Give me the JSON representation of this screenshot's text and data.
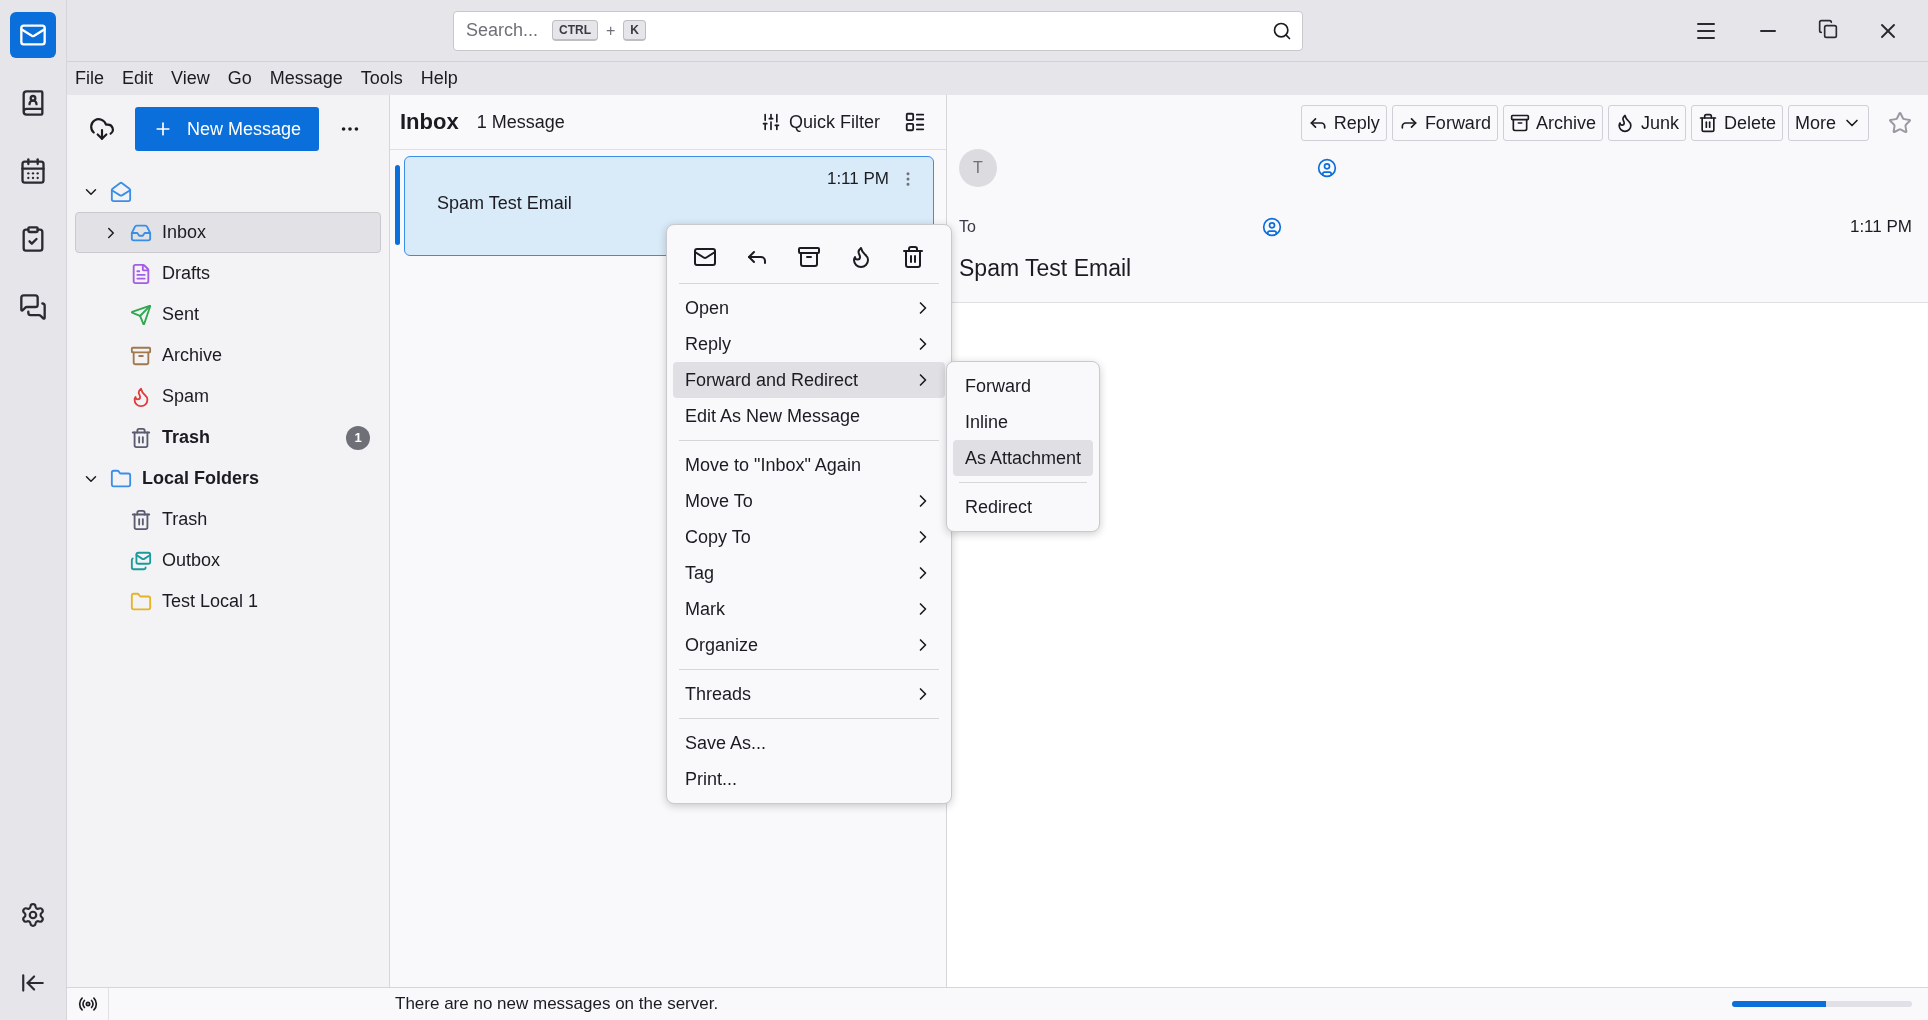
{
  "search": {
    "placeholder": "Search...",
    "keys": [
      "CTRL",
      "K"
    ],
    "joiner": "+"
  },
  "menubar": [
    "File",
    "Edit",
    "View",
    "Go",
    "Message",
    "Tools",
    "Help"
  ],
  "folder_pane": {
    "new_message": "New Message",
    "accounts": [
      {
        "kind": "mail",
        "expanded": true,
        "children": [
          {
            "label": "Inbox",
            "kind": "inbox",
            "selected": true,
            "collapsed_children": true
          },
          {
            "label": "Drafts",
            "kind": "drafts",
            "selected": false
          },
          {
            "label": "Sent",
            "kind": "sent",
            "selected": false
          },
          {
            "label": "Archive",
            "kind": "archive",
            "selected": false
          },
          {
            "label": "Spam",
            "kind": "spam",
            "selected": false
          },
          {
            "label": "Trash",
            "kind": "trash",
            "selected": false,
            "unread": "1"
          }
        ]
      },
      {
        "kind": "local",
        "label": "Local Folders",
        "expanded": true,
        "children": [
          {
            "label": "Trash",
            "kind": "trash",
            "selected": false
          },
          {
            "label": "Outbox",
            "kind": "outbox",
            "selected": false
          },
          {
            "label": "Test Local 1",
            "kind": "folder",
            "selected": false
          }
        ]
      }
    ]
  },
  "message_list": {
    "title": "Inbox",
    "count": "1 Message",
    "quick_filter": "Quick Filter",
    "messages": [
      {
        "subject": "Spam Test Email",
        "time": "1:11 PM",
        "selected": true
      }
    ]
  },
  "reader": {
    "buttons": [
      {
        "label": "Reply",
        "kind": "reply"
      },
      {
        "label": "Forward",
        "kind": "forward"
      },
      {
        "label": "Archive",
        "kind": "archive"
      },
      {
        "label": "Junk",
        "kind": "junk"
      },
      {
        "label": "Delete",
        "kind": "delete"
      },
      {
        "label": "More",
        "kind": "more"
      }
    ],
    "avatar": "T",
    "to_label": "To",
    "time": "1:11 PM",
    "subject": "Spam Test Email"
  },
  "context_menu": {
    "items": [
      {
        "label": "Open",
        "submenu": true,
        "selected": false
      },
      {
        "label": "Reply",
        "submenu": true,
        "selected": false
      },
      {
        "label": "Forward and Redirect",
        "submenu": true,
        "selected": true
      },
      {
        "label": "Edit As New Message",
        "submenu": false,
        "selected": false
      },
      {
        "kind": "separator"
      },
      {
        "label": "Move to \"Inbox\" Again",
        "submenu": false,
        "selected": false
      },
      {
        "label": "Move To",
        "submenu": true,
        "selected": false
      },
      {
        "label": "Copy To",
        "submenu": true,
        "selected": false
      },
      {
        "label": "Tag",
        "submenu": true,
        "selected": false
      },
      {
        "label": "Mark",
        "submenu": true,
        "selected": false
      },
      {
        "label": "Organize",
        "submenu": true,
        "selected": false
      },
      {
        "kind": "separator"
      },
      {
        "label": "Threads",
        "submenu": true,
        "selected": false
      },
      {
        "kind": "separator"
      },
      {
        "label": "Save As...",
        "submenu": false,
        "selected": false
      },
      {
        "label": "Print...",
        "submenu": false,
        "selected": false
      }
    ]
  },
  "submenu": {
    "items": [
      {
        "label": "Forward",
        "selected": false
      },
      {
        "label": "Inline",
        "selected": false
      },
      {
        "label": "As Attachment",
        "selected": true
      },
      {
        "kind": "separator"
      },
      {
        "label": "Redirect",
        "selected": false
      }
    ]
  },
  "status_bar": {
    "text": "There are no new messages on the server.",
    "progress": {
      "level": 0.52
    }
  }
}
